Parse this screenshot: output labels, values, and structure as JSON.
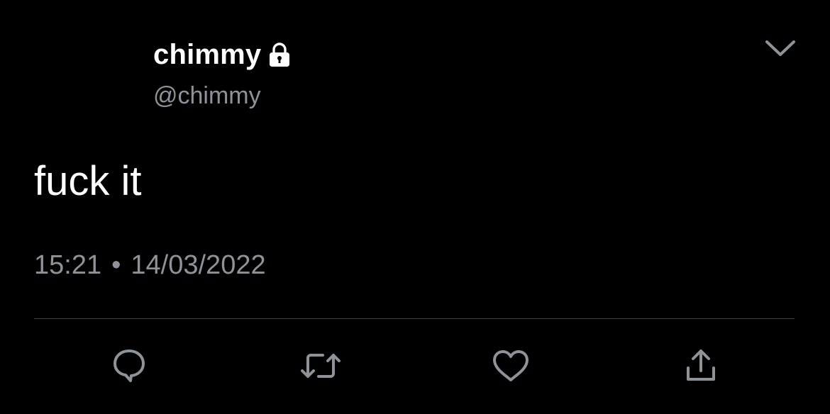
{
  "tweet": {
    "display_name": "chimmy",
    "handle": "@chimmy",
    "protected_icon": "lock-icon",
    "text": "fuck it",
    "time": "15:21",
    "separator": "•",
    "date": "14/03/2022"
  },
  "actions": [
    {
      "name": "reply",
      "icon": "reply-icon"
    },
    {
      "name": "retweet",
      "icon": "retweet-icon"
    },
    {
      "name": "like",
      "icon": "heart-icon"
    },
    {
      "name": "share",
      "icon": "share-icon"
    }
  ],
  "colors": {
    "background": "#000000",
    "primary_text": "#ffffff",
    "secondary_text": "#8e9399",
    "icon": "#8e9399",
    "divider": "#38444d"
  }
}
